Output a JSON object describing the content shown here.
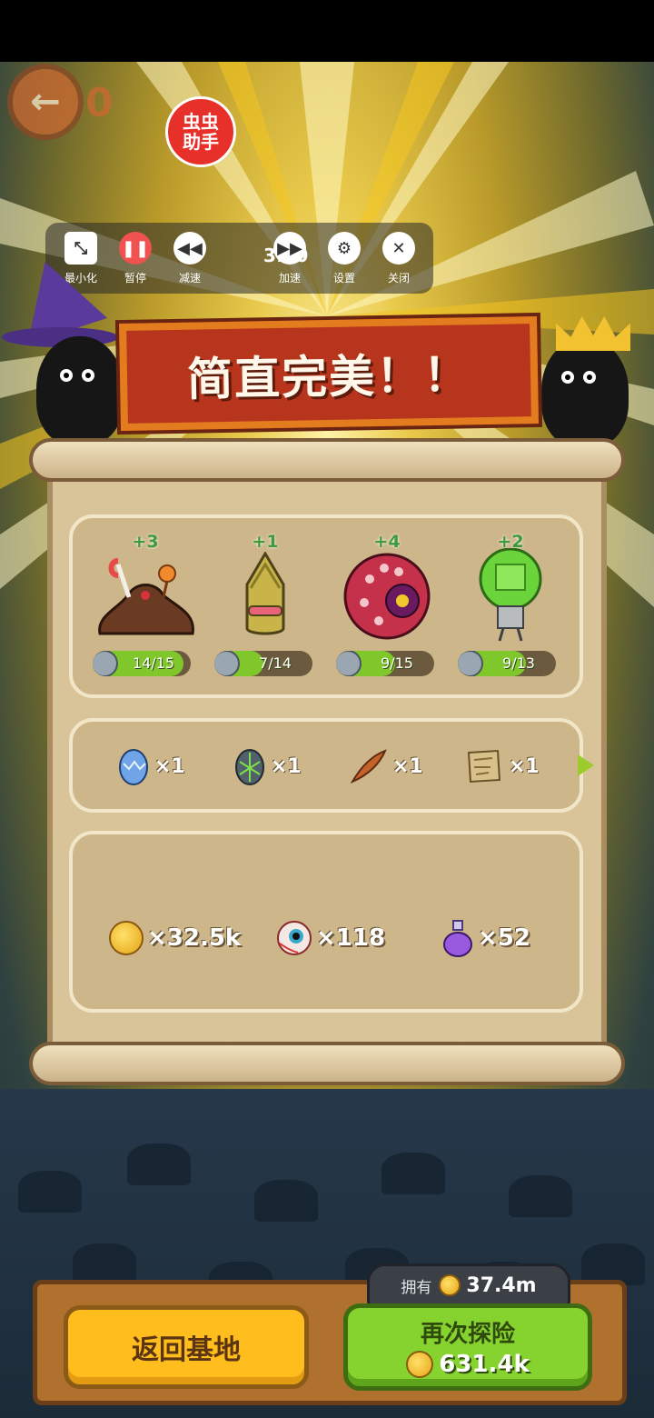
{
  "assistant": {
    "label": "虫虫\n助手"
  },
  "controls": {
    "minimize": "最小化",
    "pause": "暂停",
    "slow": "减速",
    "speed": "31.0",
    "fast": "加速",
    "settings": "设置",
    "close": "关闭"
  },
  "top_left": {
    "counter": "0"
  },
  "banner": {
    "title": "简直完美！！"
  },
  "monsters": [
    {
      "name": "chocolate-blob",
      "bonus": "+3",
      "progress": "14/15",
      "fill": 0.93
    },
    {
      "name": "pine-cone-creature",
      "bonus": "+1",
      "progress": "7/14",
      "fill": 0.5
    },
    {
      "name": "red-sea-urchin",
      "bonus": "+4",
      "progress": "9/15",
      "fill": 0.6
    },
    {
      "name": "green-jar-robot",
      "bonus": "+2",
      "progress": "9/13",
      "fill": 0.69
    }
  ],
  "items": [
    {
      "icon": "blue-egg-icon",
      "count": "×1"
    },
    {
      "icon": "green-egg-icon",
      "count": "×1"
    },
    {
      "icon": "feather-icon",
      "count": "×1"
    },
    {
      "icon": "map-scroll-icon",
      "count": "×1"
    }
  ],
  "resources": [
    {
      "icon": "gold-coin-icon",
      "count": "×32.5k"
    },
    {
      "icon": "eyeball-icon",
      "count": "×118"
    },
    {
      "icon": "potion-icon",
      "count": "×52"
    }
  ],
  "footer": {
    "owned_label": "拥有",
    "owned_value": "37.4m",
    "return_label": "返回基地",
    "again_label": "再次探险",
    "again_cost": "631.4k"
  },
  "colors": {
    "banner": "#b8351d",
    "progress": "#7fc72a",
    "return_button": "#ffbe1e",
    "again_button": "#86d22e"
  }
}
